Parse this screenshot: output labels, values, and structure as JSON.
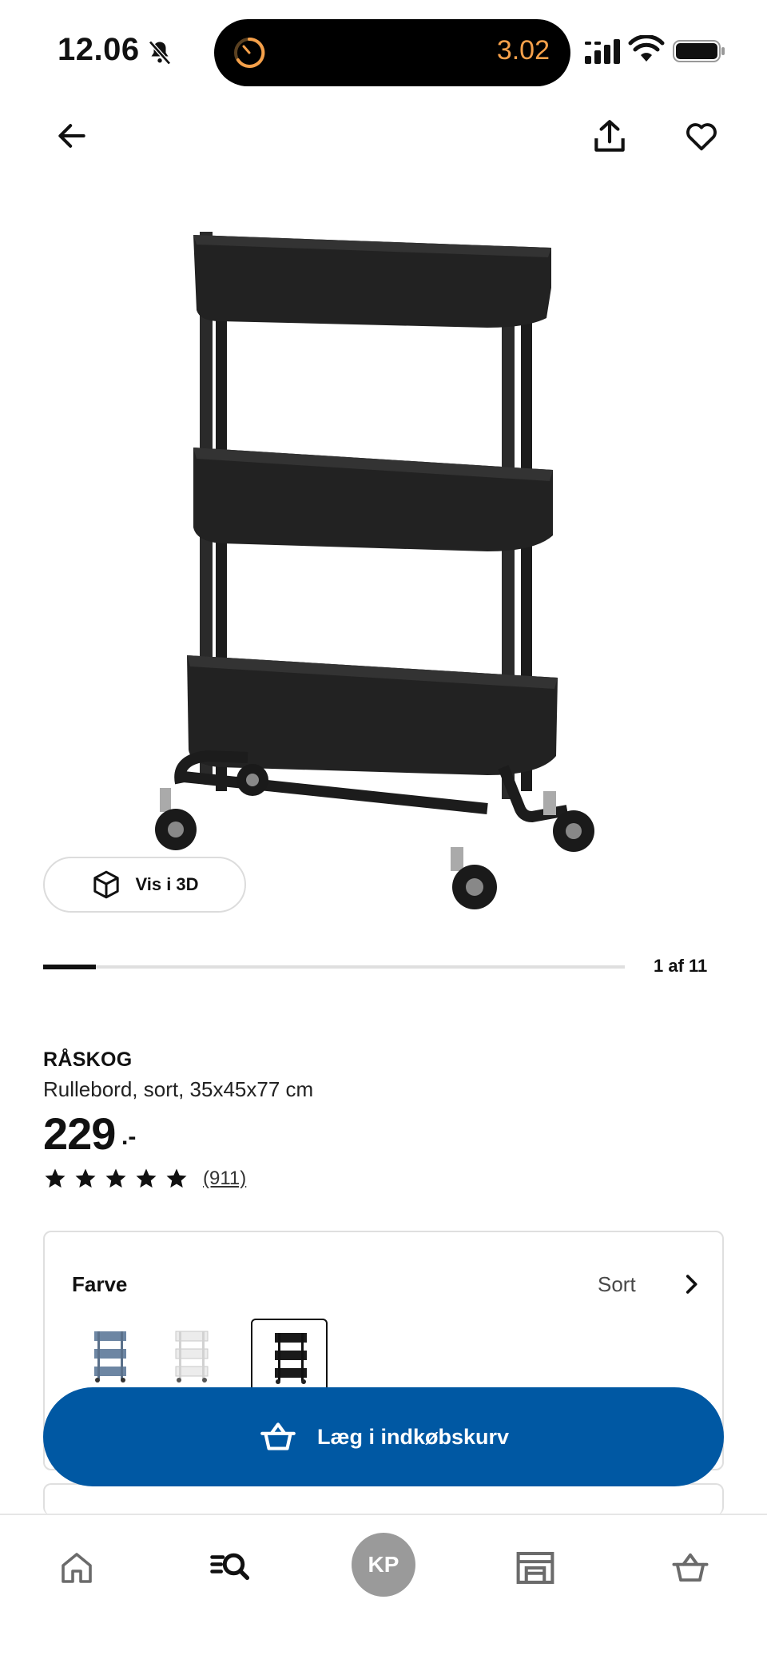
{
  "status_bar": {
    "time": "12.06",
    "island_text": "3.02",
    "bell_icon": "bell-muted-icon",
    "signal_icon": "cellular-signal-icon",
    "wifi_icon": "wifi-icon",
    "battery_icon": "battery-icon"
  },
  "top_bar": {
    "back_icon": "arrow-left-icon",
    "share_icon": "share-icon",
    "favorite_icon": "heart-icon"
  },
  "gallery": {
    "view_3d_label": "Vis i 3D",
    "counter": "1 af 11",
    "progress_fraction": 0.09
  },
  "product": {
    "name": "RÅSKOG",
    "description": "Rullebord, sort, 35x45x77 cm",
    "price": "229",
    "price_suffix": ".-",
    "rating_stars": 5,
    "review_count": "(911)"
  },
  "color_selector": {
    "label": "Farve",
    "value": "Sort",
    "swatches": [
      {
        "name": "blue-grey",
        "color": "#6d86a3"
      },
      {
        "name": "white",
        "color": "#e8e8e8"
      },
      {
        "name": "black",
        "color": "#1a1a1a",
        "selected": true
      }
    ]
  },
  "cart_button": {
    "label": "Læg i indkøbskurv",
    "color": "#0058a3"
  },
  "tab_bar": {
    "items": [
      {
        "icon": "home-icon"
      },
      {
        "icon": "search-list-icon"
      },
      {
        "avatar": "KP"
      },
      {
        "icon": "store-icon"
      },
      {
        "icon": "basket-icon"
      }
    ]
  }
}
